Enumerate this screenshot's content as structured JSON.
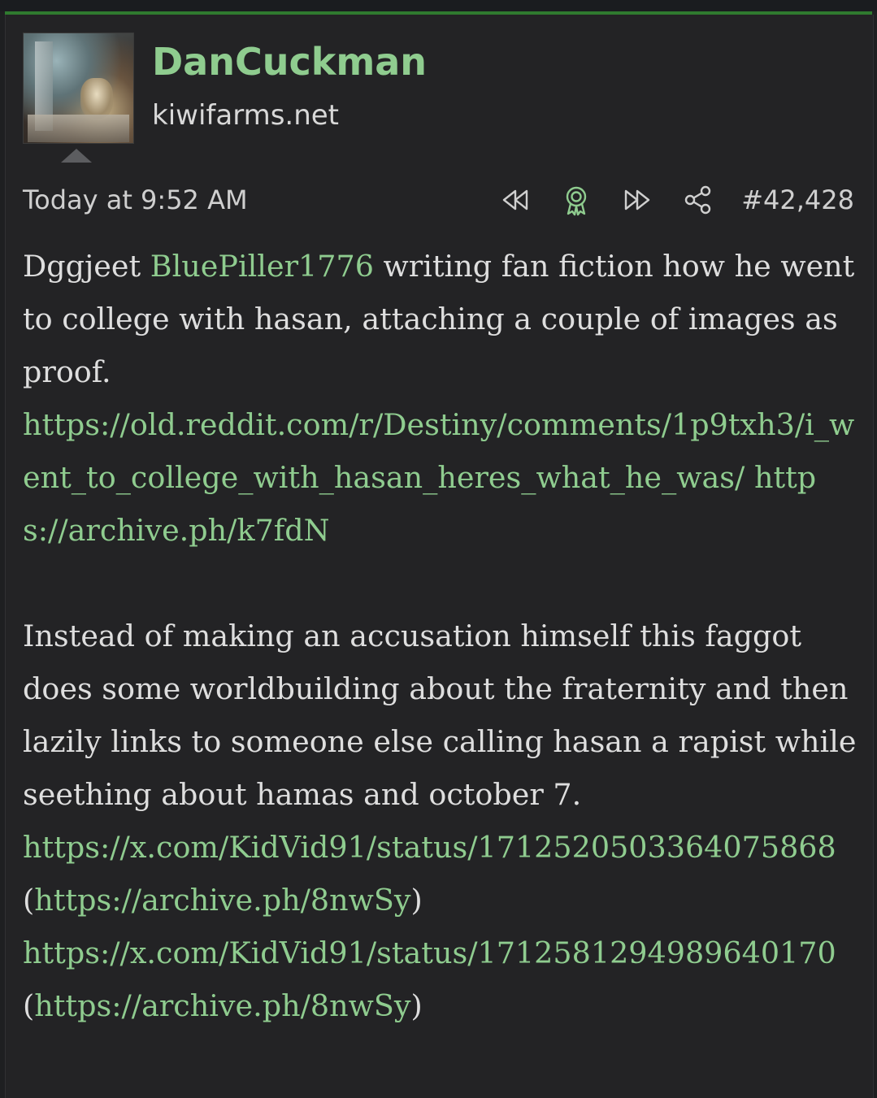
{
  "post": {
    "username": "DanCuckman",
    "site": "kiwifarms.net",
    "timestamp": "Today at 9:52 AM",
    "post_number": "#42,428",
    "icons": [
      "rewind-icon",
      "award-icon",
      "fast-forward-icon",
      "share-icon"
    ],
    "colors": {
      "accent": "#8fcc8f",
      "background": "#232325",
      "text": "#dedede",
      "top_border": "#2f7a2f"
    }
  },
  "body": {
    "p1_pre": "Dggjeet ",
    "p1_mention": "BluePiller1776",
    "p1_post": " writing fan fiction how he went to college with hasan, attaching a couple of images as proof.",
    "link_reddit": "https://old.reddit.com/r/Destiny/comments/1p9txh3/i_went_to_college_with_hasan_heres_what_he_was/",
    "link_archive1": "https://archive.ph/k7fdN",
    "p2": "Instead of making an accusation himself this faggot does some worldbuilding about the fraternity and then lazily links to someone else calling hasan a rapist while seething about hamas and october 7.",
    "link_x1": "https://x.com/KidVid91/status/1712520503364075868",
    "link_archive2": "https://archive.ph/8nwSy",
    "link_x2": "https://x.com/KidVid91/status/1712581294989640170",
    "link_archive3": "https://archive.ph/8nwSy",
    "paren_open": "(",
    "paren_close": ")"
  }
}
